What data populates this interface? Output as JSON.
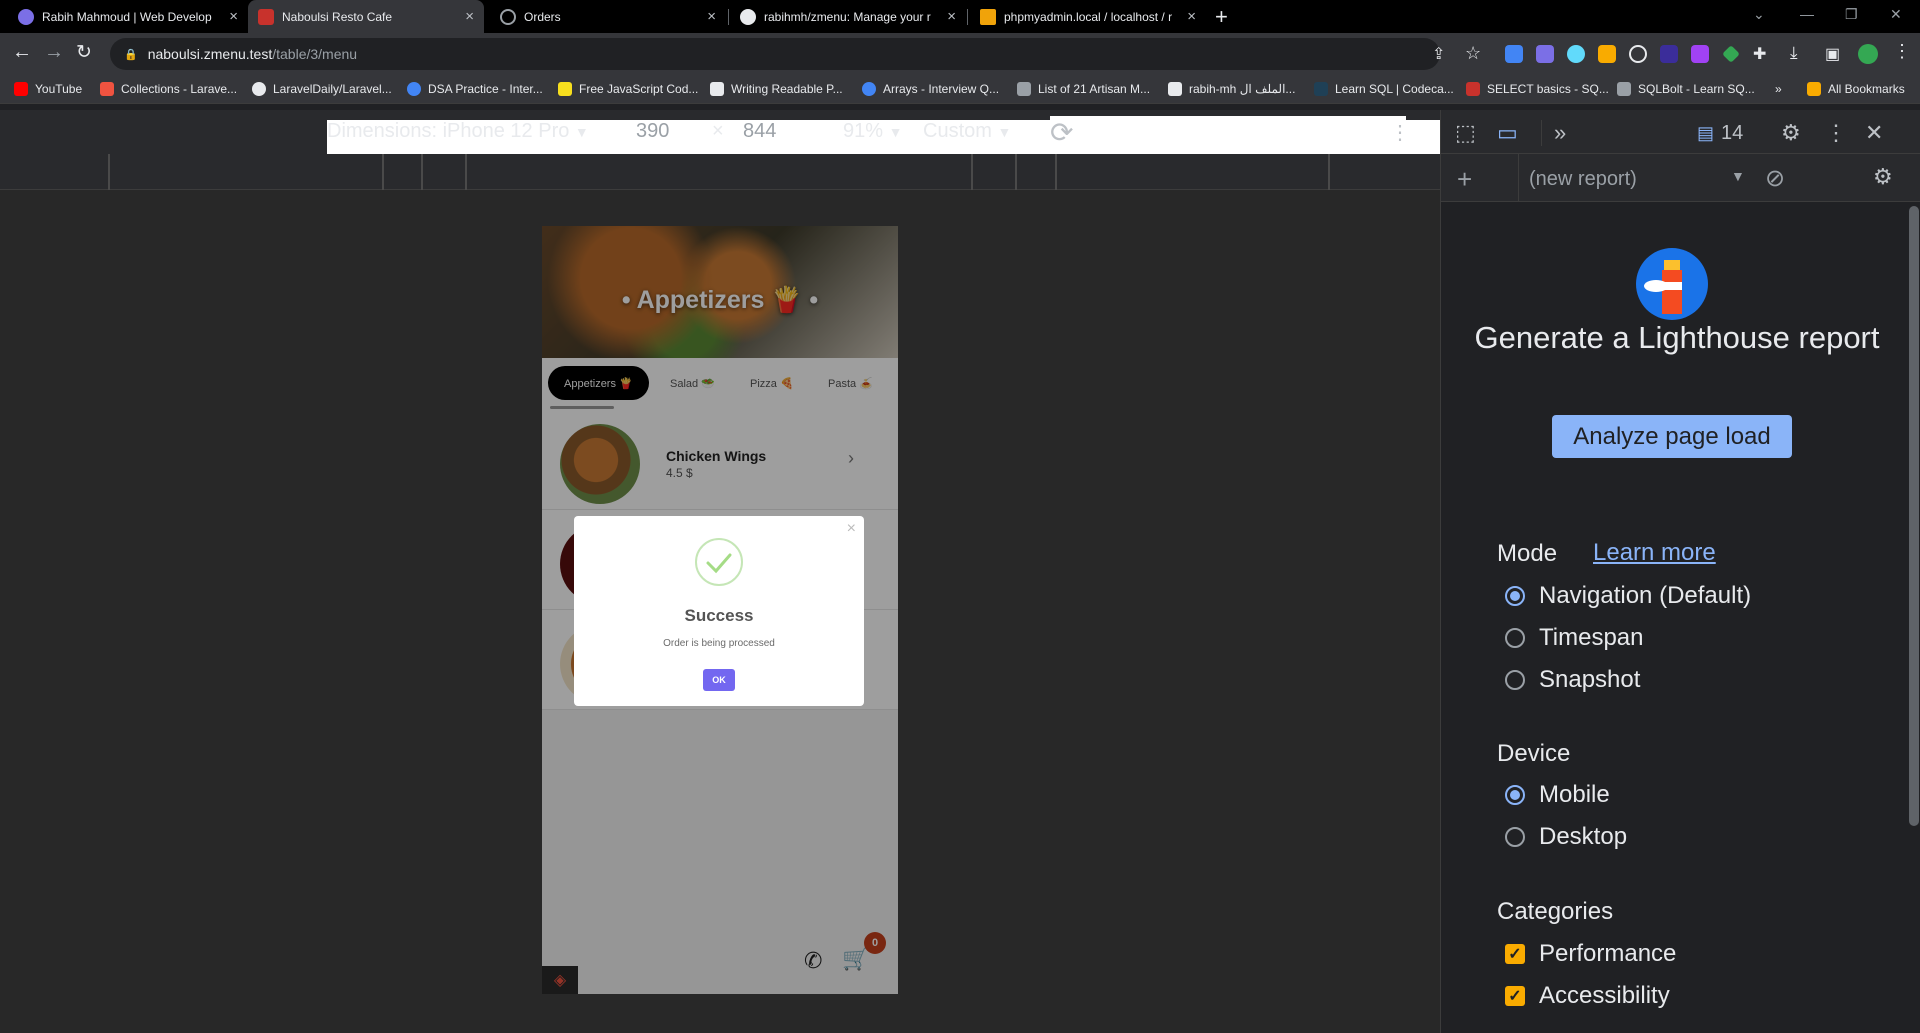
{
  "tabs": [
    {
      "title": "Rabih Mahmoud | Web Develop",
      "favicon_color": "#7b6fe6",
      "active": false
    },
    {
      "title": "Naboulsi Resto Cafe",
      "favicon_color": "#c8322c",
      "active": true
    },
    {
      "title": "Orders",
      "favicon_color": "#9aa0a6",
      "active": false
    },
    {
      "title": "rabihmh/zmenu: Manage your r",
      "favicon_color": "#e8eaed",
      "active": false
    },
    {
      "title": "phpmyadmin.local / localhost / r",
      "favicon_color": "#f0a30a",
      "active": false
    }
  ],
  "address": {
    "host": "naboulsi.zmenu.test",
    "path": "/table/3/menu"
  },
  "bookmarks": [
    {
      "label": "YouTube",
      "color": "#ff0000"
    },
    {
      "label": "Collections - Larave...",
      "color": "#f05340"
    },
    {
      "label": "LaravelDaily/Laravel...",
      "color": "#e8eaed"
    },
    {
      "label": "DSA Practice - Inter...",
      "color": "#4285f4"
    },
    {
      "label": "Free JavaScript Cod...",
      "color": "#f7df1e"
    },
    {
      "label": "Writing Readable P...",
      "color": "#e8eaed"
    },
    {
      "label": "Arrays - Interview Q...",
      "color": "#4285f4"
    },
    {
      "label": "List of 21 Artisan M...",
      "color": "#9aa0a6"
    },
    {
      "label": "rabih-mh الملف ال...",
      "color": "#e8eaed"
    },
    {
      "label": "Learn SQL | Codeca...",
      "color": "#1f4056"
    },
    {
      "label": "SELECT basics - SQ...",
      "color": "#c8322c"
    },
    {
      "label": "SQLBolt - Learn SQ...",
      "color": "#9aa0a6"
    }
  ],
  "bookmarks_more": "»",
  "all_bookmarks": "All Bookmarks",
  "device_toolbar": {
    "dimensions_label": "Dimensions: iPhone 12 Pro",
    "width": "390",
    "times": "×",
    "height": "844",
    "zoom": "91%",
    "throttle": "Custom"
  },
  "phone": {
    "hero_title": "• Appetizers 🍟 •",
    "categories": [
      {
        "label": "Appetizers 🍟",
        "active": true
      },
      {
        "label": "Salad 🥗",
        "active": false
      },
      {
        "label": "Pizza 🍕",
        "active": false
      },
      {
        "label": "Pasta 🍝",
        "active": false
      }
    ],
    "items": [
      {
        "name": "Chicken Wings",
        "price": "4.5 $"
      }
    ],
    "cart_count": "0",
    "modal": {
      "title": "Success",
      "message": "Order is being processed",
      "ok_label": "OK",
      "close_glyph": "×"
    }
  },
  "devtools": {
    "message_count": "14",
    "report_select": "(new report)",
    "heading": "Generate a Lighthouse report",
    "analyze_label": "Analyze page load",
    "mode_label": "Mode",
    "learn_more": "Learn more",
    "modes": [
      {
        "label": "Navigation (Default)",
        "selected": true
      },
      {
        "label": "Timespan",
        "selected": false
      },
      {
        "label": "Snapshot",
        "selected": false
      }
    ],
    "device_label": "Device",
    "devices": [
      {
        "label": "Mobile",
        "selected": true
      },
      {
        "label": "Desktop",
        "selected": false
      }
    ],
    "categories_label": "Categories",
    "categories": [
      {
        "label": "Performance",
        "checked": true
      },
      {
        "label": "Accessibility",
        "checked": true
      }
    ]
  }
}
